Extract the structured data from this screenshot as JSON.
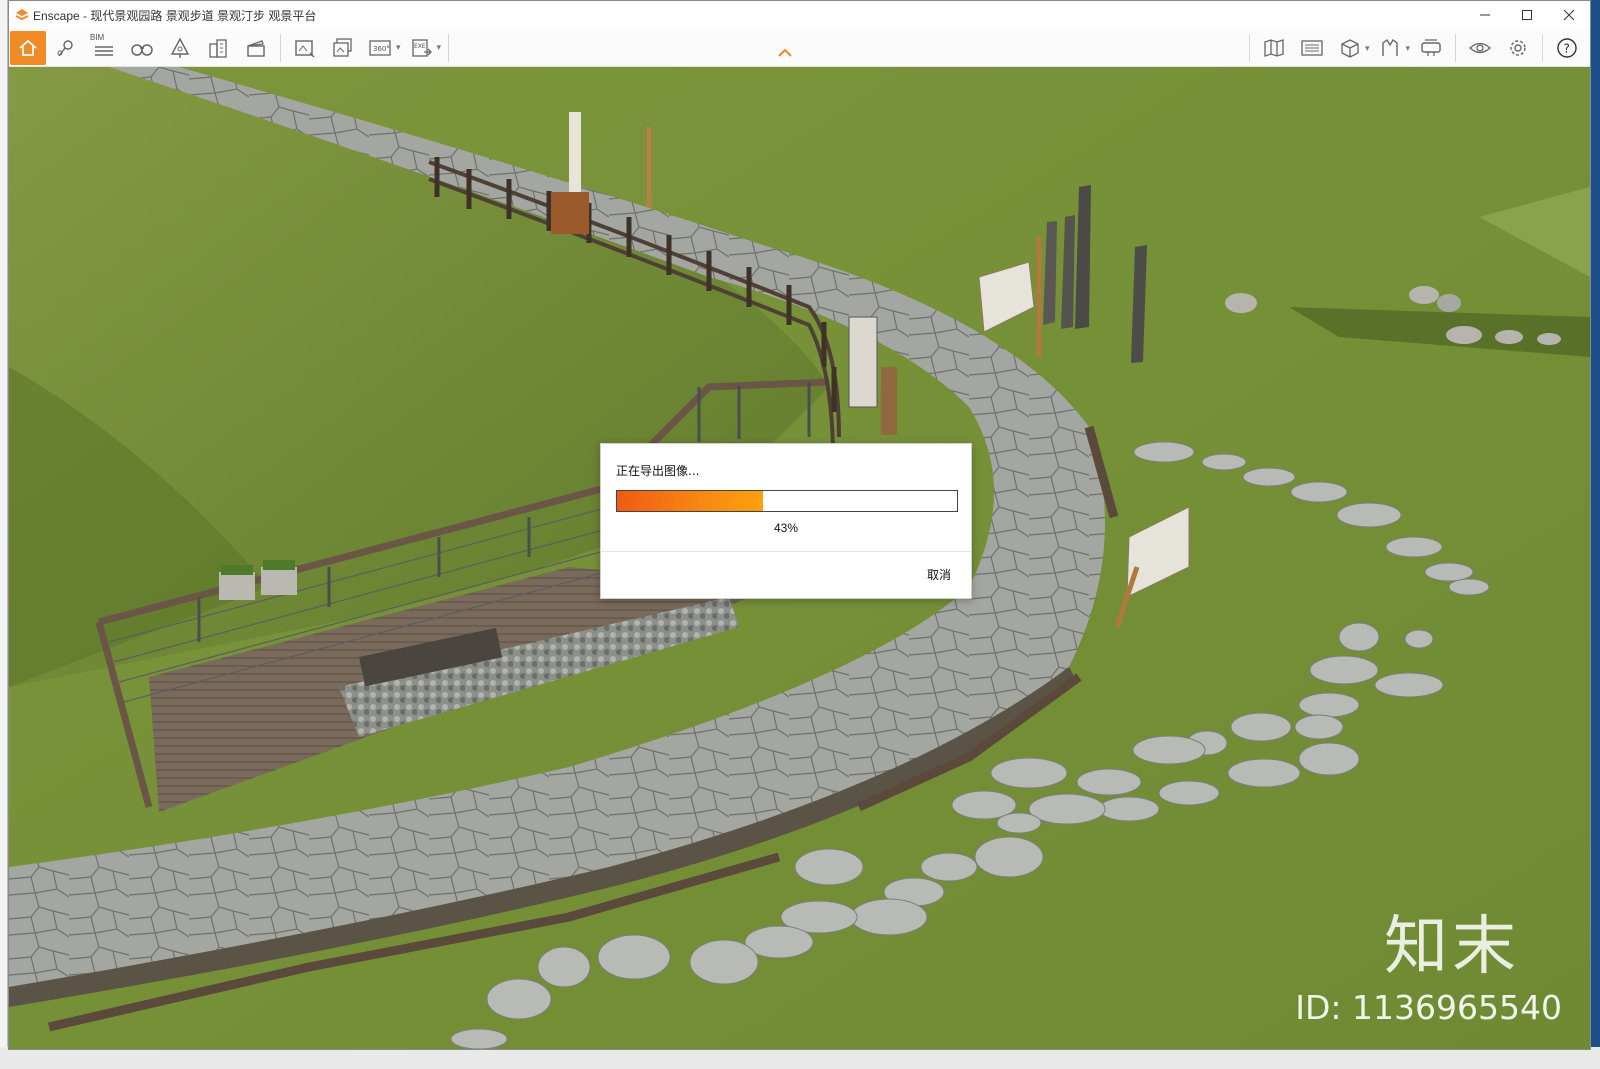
{
  "window": {
    "title": "Enscape - 现代景观园路 景观步道 景观汀步 观景平台",
    "controls": [
      "minimize-icon",
      "maximize-icon",
      "close-icon"
    ]
  },
  "toolbar": {
    "left_tools": [
      "home-icon",
      "location-pin-icon",
      "bim-icon",
      "binoculars-icon",
      "tree-icon",
      "buildings-icon",
      "clapperboard-icon",
      "render-image-icon",
      "batch-render-icon",
      "panorama-360-icon",
      "export-exe-icon"
    ],
    "right_tools": [
      "map-icon",
      "asset-library-icon",
      "cube-icon",
      "material-icon",
      "vr-headset-icon",
      "eye-icon",
      "settings-icon",
      "help-icon"
    ],
    "bim_label": "BIM",
    "panorama_label": "360°",
    "exe_label": "EXE",
    "collapse_icon": "chevron-up-icon"
  },
  "export_dialog": {
    "title": "正在导出图像...",
    "progress_percent": 43,
    "progress_text": "43%",
    "cancel_label": "取消"
  },
  "watermark": {
    "logo_text": "知末",
    "id_text": "ID: 1136965540"
  },
  "colors": {
    "accent": "#f08a24",
    "progress_start": "#f05a14",
    "progress_end": "#ffa00f",
    "grass": "#7b953d",
    "path_stone": "#a9aba6"
  }
}
